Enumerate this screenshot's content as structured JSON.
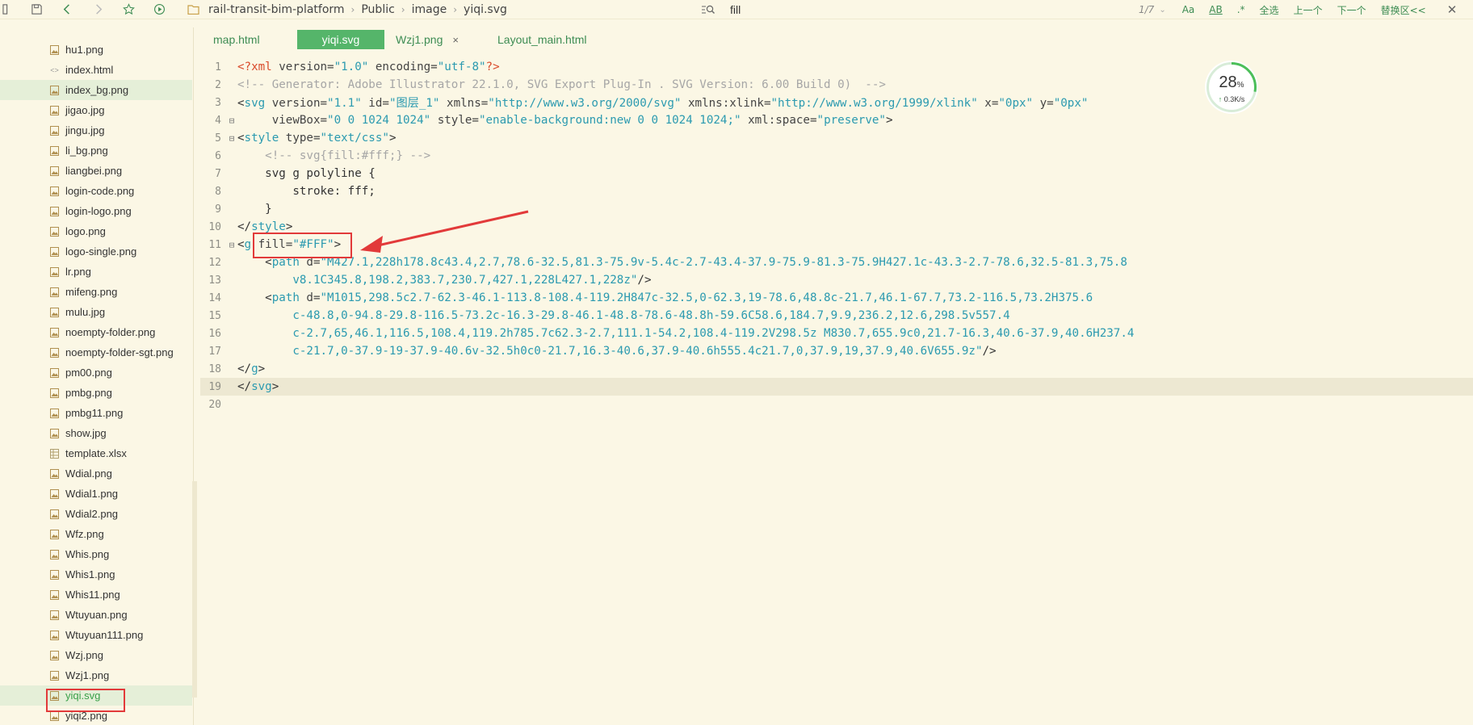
{
  "toolbar": {
    "icons": [
      "sidebar-toggle-icon",
      "save-icon",
      "back-icon",
      "forward-icon",
      "bookmark-icon",
      "run-icon"
    ]
  },
  "breadcrumb": [
    "rail-transit-bim-platform",
    "Public",
    "image",
    "yiqi.svg"
  ],
  "search": {
    "value": "fill",
    "count": "1/7"
  },
  "find_controls": {
    "case": "Aa",
    "whole_word": "AB",
    "regex": ".*",
    "select_all": "全选",
    "prev": "上一个",
    "next": "下一个",
    "replace": "替换区<<"
  },
  "sidebar": {
    "files": [
      {
        "name": "hu1.png",
        "type": "image"
      },
      {
        "name": "index.html",
        "type": "code"
      },
      {
        "name": "index_bg.png",
        "type": "image",
        "active": true
      },
      {
        "name": "jigao.jpg",
        "type": "image"
      },
      {
        "name": "jingu.jpg",
        "type": "image"
      },
      {
        "name": "li_bg.png",
        "type": "image"
      },
      {
        "name": "liangbei.png",
        "type": "image"
      },
      {
        "name": "login-code.png",
        "type": "image"
      },
      {
        "name": "login-logo.png",
        "type": "image"
      },
      {
        "name": "logo.png",
        "type": "image"
      },
      {
        "name": "logo-single.png",
        "type": "image"
      },
      {
        "name": "lr.png",
        "type": "image"
      },
      {
        "name": "mifeng.png",
        "type": "image"
      },
      {
        "name": "mulu.jpg",
        "type": "image"
      },
      {
        "name": "noempty-folder.png",
        "type": "image"
      },
      {
        "name": "noempty-folder-sgt.png",
        "type": "image"
      },
      {
        "name": "pm00.png",
        "type": "image"
      },
      {
        "name": "pmbg.png",
        "type": "image"
      },
      {
        "name": "pmbg11.png",
        "type": "image"
      },
      {
        "name": "show.jpg",
        "type": "image"
      },
      {
        "name": "template.xlsx",
        "type": "sheet"
      },
      {
        "name": "Wdial.png",
        "type": "image"
      },
      {
        "name": "Wdial1.png",
        "type": "image"
      },
      {
        "name": "Wdial2.png",
        "type": "image"
      },
      {
        "name": "Wfz.png",
        "type": "image"
      },
      {
        "name": "Whis.png",
        "type": "image"
      },
      {
        "name": "Whis1.png",
        "type": "image"
      },
      {
        "name": "Whis11.png",
        "type": "image"
      },
      {
        "name": "Wtuyuan.png",
        "type": "image"
      },
      {
        "name": "Wtuyuan111.png",
        "type": "image"
      },
      {
        "name": "Wzj.png",
        "type": "image"
      },
      {
        "name": "Wzj1.png",
        "type": "image"
      },
      {
        "name": "yiqi.svg",
        "type": "image",
        "current": true
      },
      {
        "name": "yiqi2.png",
        "type": "image"
      }
    ]
  },
  "tabs": [
    {
      "label": "map.html",
      "active": false,
      "close": ""
    },
    {
      "label": "yiqi.svg",
      "active": true,
      "close": ""
    },
    {
      "label": "Wzj1.png",
      "active": false,
      "close": "×"
    },
    {
      "label": "Layout_main.html",
      "active": false,
      "close": ""
    }
  ],
  "speed": {
    "percent": "28",
    "unit": "%",
    "rate": "0.3K/s",
    "level": 0.28
  },
  "colors": {
    "accent": "#55b56a",
    "highlight": "#e23a3a",
    "background": "#fbf7e5"
  },
  "code_lines": [
    {
      "n": "1",
      "fold": "",
      "tokens": [
        [
          "t-decl",
          "<?xml"
        ],
        [
          "t-attr",
          " version="
        ],
        [
          "t-str",
          "\"1.0\""
        ],
        [
          "t-attr",
          " encoding="
        ],
        [
          "t-str",
          "\"utf-8\""
        ],
        [
          "t-decl",
          "?>"
        ]
      ]
    },
    {
      "n": "2",
      "fold": "",
      "tokens": [
        [
          "t-com",
          "<!-- Generator: Adobe Illustrator 22.1.0, SVG Export Plug-In . SVG Version: 6.00 Build 0)  -->"
        ]
      ]
    },
    {
      "n": "3",
      "fold": "",
      "tokens": [
        [
          "t-pun",
          "<"
        ],
        [
          "t-tag",
          "svg"
        ],
        [
          "t-attr",
          " version="
        ],
        [
          "t-str",
          "\"1.1\""
        ],
        [
          "t-attr",
          " id="
        ],
        [
          "t-str",
          "\"图层_1\""
        ],
        [
          "t-attr",
          " xmlns="
        ],
        [
          "t-str",
          "\"http://www.w3.org/2000/svg\""
        ],
        [
          "t-attr",
          " xmlns:xlink="
        ],
        [
          "t-str",
          "\"http://www.w3.org/1999/xlink\""
        ],
        [
          "t-attr",
          " x="
        ],
        [
          "t-str",
          "\"0px\""
        ],
        [
          "t-attr",
          " y="
        ],
        [
          "t-str",
          "\"0px\""
        ]
      ]
    },
    {
      "n": "4",
      "fold": "⊟",
      "tokens": [
        [
          "t-attr",
          "     viewBox="
        ],
        [
          "t-str",
          "\"0 0 1024 1024\""
        ],
        [
          "t-attr",
          " style="
        ],
        [
          "t-str",
          "\"enable-background:new 0 0 1024 1024;\""
        ],
        [
          "t-attr",
          " xml:space="
        ],
        [
          "t-str",
          "\"preserve\""
        ],
        [
          "t-pun",
          ">"
        ]
      ]
    },
    {
      "n": "5",
      "fold": "⊟",
      "tokens": [
        [
          "t-pun",
          "<"
        ],
        [
          "t-tag",
          "style"
        ],
        [
          "t-attr",
          " type="
        ],
        [
          "t-str",
          "\"text/css\""
        ],
        [
          "t-pun",
          ">"
        ]
      ]
    },
    {
      "n": "6",
      "fold": "",
      "tokens": [
        [
          "t-com",
          "    <!-- svg{fill:#fff;} -->"
        ]
      ]
    },
    {
      "n": "7",
      "fold": "",
      "tokens": [
        [
          "t-plain",
          "    svg g polyline {"
        ]
      ]
    },
    {
      "n": "8",
      "fold": "",
      "tokens": [
        [
          "t-plain",
          "        stroke: fff;"
        ]
      ]
    },
    {
      "n": "9",
      "fold": "",
      "tokens": [
        [
          "t-plain",
          "    }"
        ]
      ]
    },
    {
      "n": "10",
      "fold": "",
      "tokens": [
        [
          "t-pun",
          "</"
        ],
        [
          "t-tag",
          "style"
        ],
        [
          "t-pun",
          ">"
        ]
      ]
    },
    {
      "n": "11",
      "fold": "⊟",
      "tokens": [
        [
          "t-pun",
          "<"
        ],
        [
          "t-tag",
          "g"
        ],
        [
          "t-attr",
          " fill="
        ],
        [
          "t-str",
          "\"#FFF\""
        ],
        [
          "t-pun",
          ">"
        ]
      ]
    },
    {
      "n": "12",
      "fold": "",
      "tokens": [
        [
          "t-pun",
          "    <"
        ],
        [
          "t-tag",
          "path"
        ],
        [
          "t-attr",
          " d="
        ],
        [
          "t-str",
          "\"M427.1,228h178.8c43.4,2.7,78.6-32.5,81.3-75.9v-5.4c-2.7-43.4-37.9-75.9-81.3-75.9H427.1c-43.3-2.7-78.6,32.5-81.3,75.8"
        ]
      ]
    },
    {
      "n": "13",
      "fold": "",
      "tokens": [
        [
          "t-str",
          "        v8.1C345.8,198.2,383.7,230.7,427.1,228L427.1,228z\""
        ],
        [
          "t-pun",
          "/>"
        ]
      ]
    },
    {
      "n": "14",
      "fold": "",
      "tokens": [
        [
          "t-pun",
          "    <"
        ],
        [
          "t-tag",
          "path"
        ],
        [
          "t-attr",
          " d="
        ],
        [
          "t-str",
          "\"M1015,298.5c2.7-62.3-46.1-113.8-108.4-119.2H847c-32.5,0-62.3,19-78.6,48.8c-21.7,46.1-67.7,73.2-116.5,73.2H375.6"
        ]
      ]
    },
    {
      "n": "15",
      "fold": "",
      "tokens": [
        [
          "t-str",
          "        c-48.8,0-94.8-29.8-116.5-73.2c-16.3-29.8-46.1-48.8-78.6-48.8h-59.6C58.6,184.7,9.9,236.2,12.6,298.5v557.4"
        ]
      ]
    },
    {
      "n": "16",
      "fold": "",
      "tokens": [
        [
          "t-str",
          "        c-2.7,65,46.1,116.5,108.4,119.2h785.7c62.3-2.7,111.1-54.2,108.4-119.2V298.5z M830.7,655.9c0,21.7-16.3,40.6-37.9,40.6H237.4"
        ]
      ]
    },
    {
      "n": "17",
      "fold": "",
      "tokens": [
        [
          "t-str",
          "        c-21.7,0-37.9-19-37.9-40.6v-32.5h0c0-21.7,16.3-40.6,37.9-40.6h555.4c21.7,0,37.9,19,37.9,40.6V655.9z\""
        ],
        [
          "t-pun",
          "/>"
        ]
      ]
    },
    {
      "n": "18",
      "fold": "",
      "tokens": [
        [
          "t-pun",
          "</"
        ],
        [
          "t-tag",
          "g"
        ],
        [
          "t-pun",
          ">"
        ]
      ]
    },
    {
      "n": "19",
      "fold": "",
      "highlight": true,
      "tokens": [
        [
          "t-pun",
          "</"
        ],
        [
          "t-tag",
          "svg"
        ],
        [
          "t-pun",
          ">"
        ]
      ]
    },
    {
      "n": "20",
      "fold": "",
      "tokens": []
    }
  ]
}
